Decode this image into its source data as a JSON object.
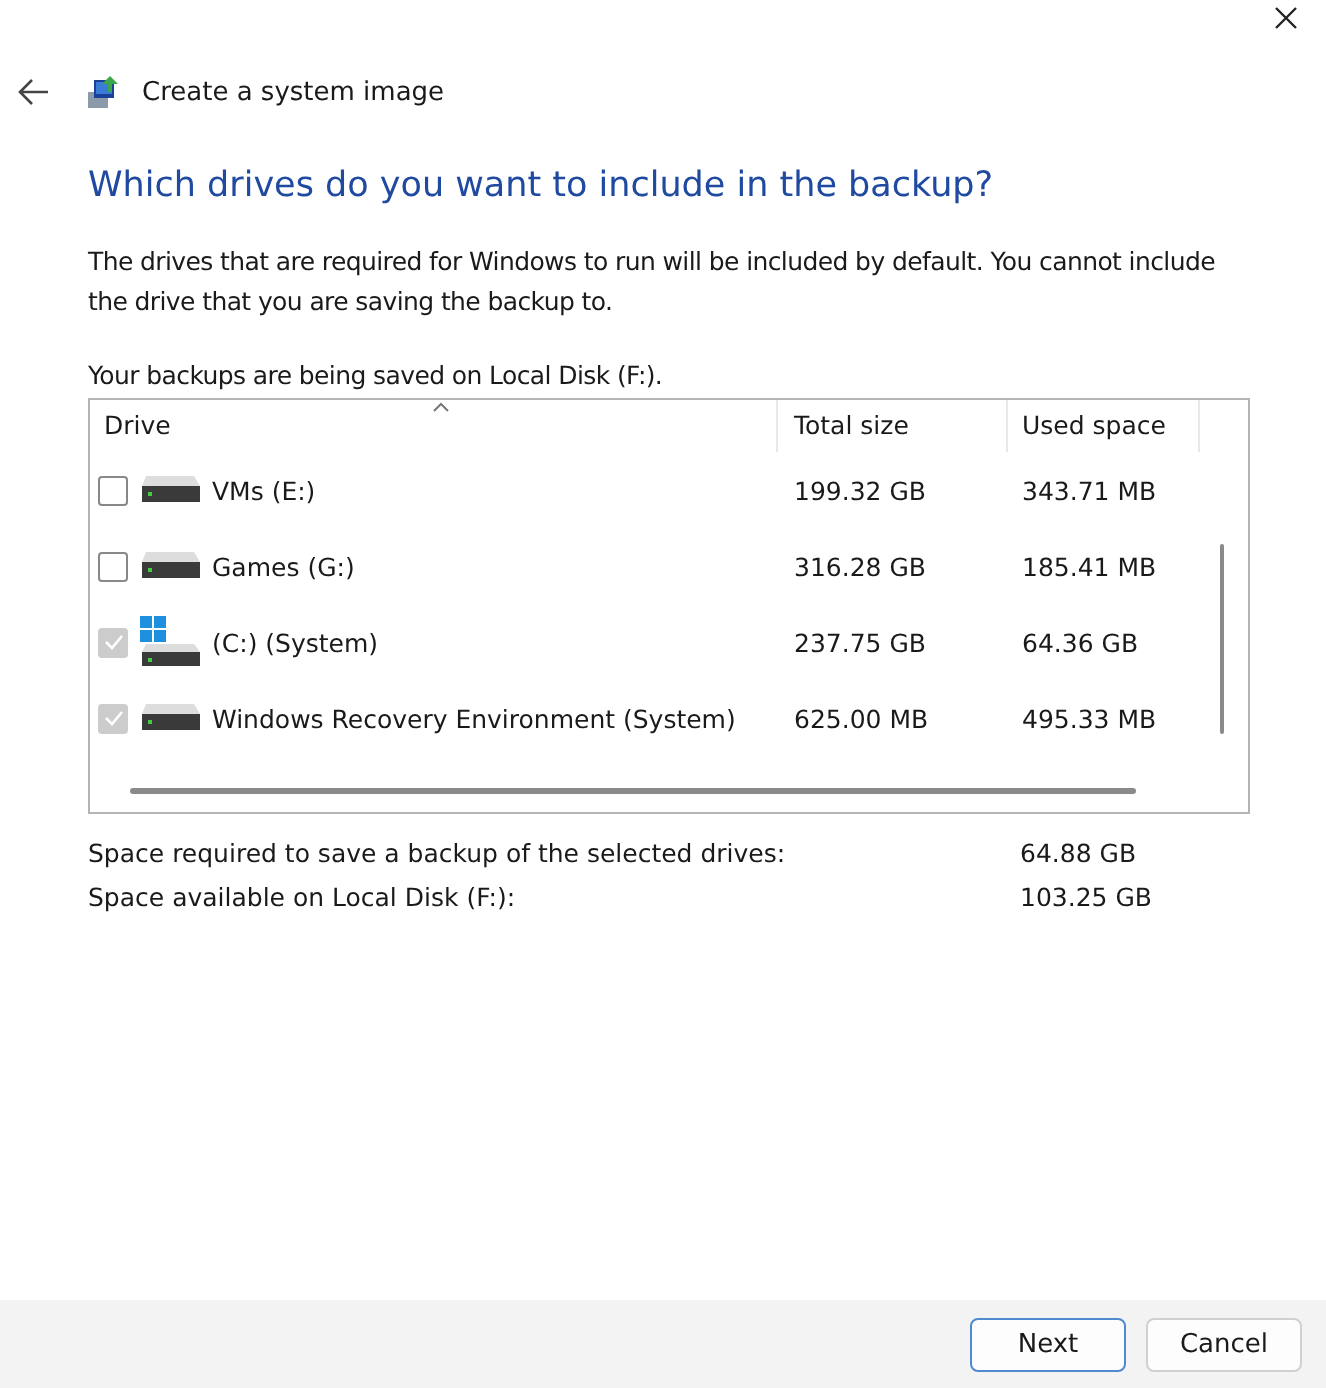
{
  "window": {
    "title": "Create a system image"
  },
  "heading": "Which drives do you want to include in the backup?",
  "description": "The drives that are required for Windows to run will be included by default. You cannot include the drive that you are saving the backup to.",
  "save_location": "Your backups are being saved on Local Disk (F:).",
  "table": {
    "columns": [
      "Drive",
      "Total size",
      "Used space"
    ],
    "rows": [
      {
        "kind": "drive",
        "name": "VMs (E:)",
        "total": "199.32 GB",
        "used": "343.71 MB",
        "checked": false,
        "disabled": false
      },
      {
        "kind": "drive",
        "name": "Games (G:)",
        "total": "316.28 GB",
        "used": "185.41 MB",
        "checked": false,
        "disabled": false
      },
      {
        "kind": "system",
        "name": "(C:) (System)",
        "total": "237.75 GB",
        "used": "64.36 GB",
        "checked": true,
        "disabled": true
      },
      {
        "kind": "drive",
        "name": "Windows Recovery Environment (System)",
        "total": "625.00 MB",
        "used": "495.33 MB",
        "checked": true,
        "disabled": true
      }
    ]
  },
  "summary": [
    {
      "label": "Space required to save a backup of the selected drives:",
      "value": "64.88 GB"
    },
    {
      "label": "Space available on Local Disk (F:):",
      "value": "103.25 GB"
    }
  ],
  "buttons": [
    {
      "label": "Next",
      "primary": true
    },
    {
      "label": "Cancel",
      "primary": false
    }
  ]
}
